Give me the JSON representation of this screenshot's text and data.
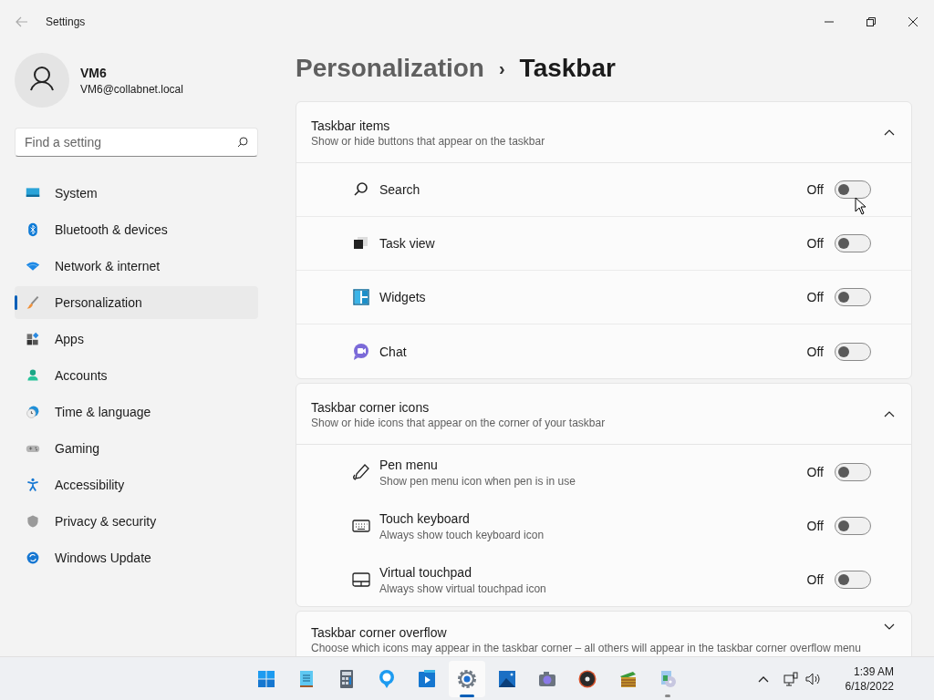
{
  "window": {
    "title": "Settings"
  },
  "account": {
    "name": "VM6",
    "email": "VM6@collabnet.local"
  },
  "search": {
    "placeholder": "Find a setting"
  },
  "nav": [
    {
      "label": "System",
      "kind": "system",
      "selected": false
    },
    {
      "label": "Bluetooth & devices",
      "kind": "bluetooth",
      "selected": false
    },
    {
      "label": "Network & internet",
      "kind": "network",
      "selected": false
    },
    {
      "label": "Personalization",
      "kind": "brush",
      "selected": true
    },
    {
      "label": "Apps",
      "kind": "apps",
      "selected": false
    },
    {
      "label": "Accounts",
      "kind": "accounts",
      "selected": false
    },
    {
      "label": "Time & language",
      "kind": "time",
      "selected": false
    },
    {
      "label": "Gaming",
      "kind": "gaming",
      "selected": false
    },
    {
      "label": "Accessibility",
      "kind": "accessibility",
      "selected": false
    },
    {
      "label": "Privacy & security",
      "kind": "privacy",
      "selected": false
    },
    {
      "label": "Windows Update",
      "kind": "update",
      "selected": false
    }
  ],
  "breadcrumb": {
    "parent": "Personalization",
    "separator": "›",
    "current": "Taskbar"
  },
  "sections": [
    {
      "title": "Taskbar items",
      "subtitle": "Show or hide buttons that appear on the taskbar",
      "expanded": true,
      "rows": [
        {
          "label": "Search",
          "kind": "search",
          "state": "Off",
          "on": false
        },
        {
          "label": "Task view",
          "kind": "taskview",
          "state": "Off",
          "on": false
        },
        {
          "label": "Widgets",
          "kind": "widgets",
          "state": "Off",
          "on": false
        },
        {
          "label": "Chat",
          "kind": "chat",
          "state": "Off",
          "on": false
        }
      ]
    },
    {
      "title": "Taskbar corner icons",
      "subtitle": "Show or hide icons that appear on the corner of your taskbar",
      "expanded": true,
      "rows": [
        {
          "label": "Pen menu",
          "description": "Show pen menu icon when pen is in use",
          "kind": "pen",
          "state": "Off",
          "on": false
        },
        {
          "label": "Touch keyboard",
          "description": "Always show touch keyboard icon",
          "kind": "keyboard",
          "state": "Off",
          "on": false
        },
        {
          "label": "Virtual touchpad",
          "description": "Always show virtual touchpad icon",
          "kind": "touchpad",
          "state": "Off",
          "on": false
        }
      ]
    },
    {
      "title": "Taskbar corner overflow",
      "subtitle": "Choose which icons may appear in the taskbar corner – all others will appear in the taskbar corner overflow menu",
      "expanded": false
    }
  ],
  "taskbar": {
    "apps": [
      {
        "kind": "start",
        "selected": false,
        "running": false
      },
      {
        "kind": "notepad",
        "selected": false,
        "running": false
      },
      {
        "kind": "calculator",
        "selected": false,
        "running": false
      },
      {
        "kind": "tips",
        "selected": false,
        "running": false
      },
      {
        "kind": "media",
        "selected": false,
        "running": false
      },
      {
        "kind": "settings",
        "selected": true,
        "running": true
      },
      {
        "kind": "photos",
        "selected": false,
        "running": false
      },
      {
        "kind": "camera",
        "selected": false,
        "running": false
      },
      {
        "kind": "music",
        "selected": false,
        "running": false
      },
      {
        "kind": "archive",
        "selected": false,
        "running": false
      },
      {
        "kind": "disc",
        "selected": false,
        "running": true
      }
    ],
    "time": "1:39 AM",
    "date": "6/18/2022"
  }
}
